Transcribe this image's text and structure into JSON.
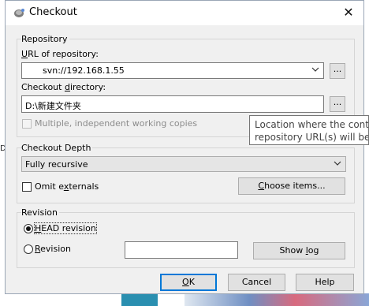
{
  "window": {
    "title": "Checkout",
    "close_glyph": "✕"
  },
  "background": {
    "left_text": "Da"
  },
  "repository": {
    "legend": "Repository",
    "url_label_key": "U",
    "url_label_rest": "RL of repository:",
    "url_value": "svn://192.168.1.55",
    "browse_url_label": "...",
    "dir_label_pre": "Checkout ",
    "dir_label_key": "d",
    "dir_label_rest": "irectory:",
    "dir_value": "D:\\新建文件夹",
    "browse_dir_label": "...",
    "multiple_wc_label": "Multiple, independent working copies",
    "multiple_wc_checked": false
  },
  "depth": {
    "legend": "Checkout Depth",
    "selected": "Fully recursive",
    "omit_label_pre": "Omit e",
    "omit_label_key": "x",
    "omit_label_rest": "ternals",
    "omit_checked": false,
    "choose_label_key": "C",
    "choose_label_rest": "hoose items..."
  },
  "revision": {
    "legend": "Revision",
    "head_label_key": "H",
    "head_label_rest": "EAD revision",
    "head_selected": true,
    "rev_label_key": "R",
    "rev_label_rest": "evision",
    "rev_value": "",
    "showlog_label_pre": "Show ",
    "showlog_label_key": "l",
    "showlog_label_rest": "og"
  },
  "buttons": {
    "ok_key": "O",
    "ok_rest": "K",
    "cancel": "Cancel",
    "help": "Help"
  },
  "tooltip": {
    "line1": "Location where the conte",
    "line2": "repository URL(s) will be"
  }
}
